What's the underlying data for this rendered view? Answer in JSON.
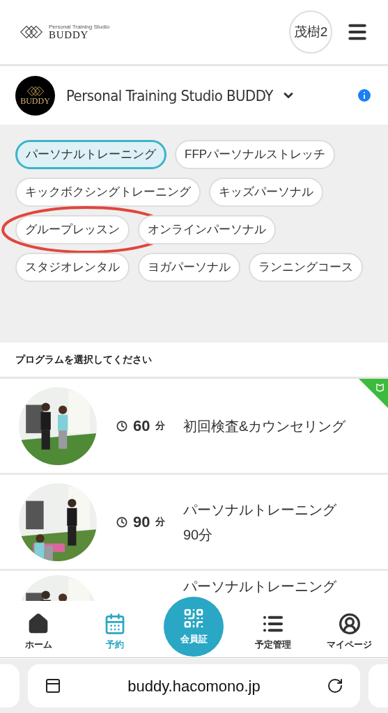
{
  "header": {
    "logo_small": "Personal Training Studio",
    "logo_name": "BUDDY",
    "user_badge": "茂樹2"
  },
  "studio": {
    "name": "Personal Training Studio BUDDY",
    "logo_name": "BUDDY"
  },
  "categories": [
    {
      "label": "パーソナルトレーニング",
      "selected": true,
      "circled": false
    },
    {
      "label": "FFPパーソナルストレッチ",
      "selected": false,
      "circled": false
    },
    {
      "label": "キックボクシングトレーニング",
      "selected": false,
      "circled": false
    },
    {
      "label": "キッズパーソナル",
      "selected": false,
      "circled": false
    },
    {
      "label": "グループレッスン",
      "selected": false,
      "circled": true
    },
    {
      "label": "オンラインパーソナル",
      "selected": false,
      "circled": false
    },
    {
      "label": "スタジオレンタル",
      "selected": false,
      "circled": false
    },
    {
      "label": "ヨガパーソナル",
      "selected": false,
      "circled": false
    },
    {
      "label": "ランニングコース",
      "selected": false,
      "circled": false
    }
  ],
  "section_title": "プログラムを選択してください",
  "programs": [
    {
      "kind": "picture",
      "duration": "60",
      "unit": "分",
      "title": "初回検査&カウンセリング",
      "beginner": true
    },
    {
      "kind": "picture",
      "duration": "90",
      "unit": "分",
      "title": "パーソナルトレーニング\n90分",
      "beginner": false
    },
    {
      "kind": "picture",
      "title": "パーソナルトレーニング",
      "beginner": false
    }
  ],
  "bottom_nav": [
    {
      "label": "ホーム",
      "selected": false
    },
    {
      "label": "予約",
      "selected": true
    },
    {
      "label": "会員証",
      "selected": false
    },
    {
      "label": "予定管理",
      "selected": false
    },
    {
      "label": "マイページ",
      "selected": false
    }
  ],
  "browser": {
    "url": "buddy.hacomono.jp"
  }
}
